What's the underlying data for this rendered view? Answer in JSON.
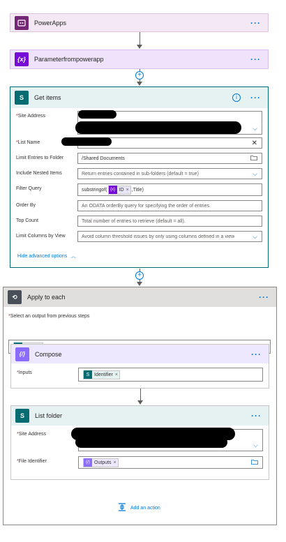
{
  "steps": {
    "powerapps": {
      "title": "PowerApps",
      "icon": "powerapps-icon",
      "color": "#742774"
    },
    "parameter": {
      "title": "Parameterfrompowerapp",
      "icon": "variable-icon",
      "color": "#770bd6"
    },
    "get_items": {
      "title": "Get items",
      "icon": "sharepoint-icon",
      "color": "#036c70",
      "info_icon": "info-icon",
      "fields": {
        "site_address": {
          "label": "Site Address",
          "required": "*"
        },
        "list_name": {
          "label": "List Name",
          "required": "*"
        },
        "limit_folder": {
          "label": "Limit Entries to Folder",
          "value": "/Shared Documents"
        },
        "nested_items": {
          "label": "Include Nested Items",
          "placeholder": "Return entries contained in sub-folders (default = true)"
        },
        "filter_query": {
          "label": "Filter Query",
          "prefix": "substringof(",
          "token": "ID",
          "suffix": ",Title)"
        },
        "order_by": {
          "label": "Order By",
          "placeholder": "An ODATA orderBy query for specifying the order of entries."
        },
        "top_count": {
          "label": "Top Count",
          "placeholder": "Total number of entries to retrieve (default = all)."
        },
        "limit_columns": {
          "label": "Limit Columns by View",
          "placeholder": "Avoid column threshold issues by only using columns defined in a view"
        }
      },
      "hide_advanced": "Hide advanced options"
    },
    "apply_each": {
      "title": "Apply to each",
      "icon": "loop-icon",
      "color": "#484f58",
      "select_label": "Select an output from previous steps",
      "select_required": "*",
      "token": "value"
    },
    "compose": {
      "title": "Compose",
      "icon": "compose-icon",
      "color": "#8c6cff",
      "inputs_label": "Inputs",
      "inputs_required": "*",
      "token": "Identifier"
    },
    "list_folder": {
      "title": "List folder",
      "icon": "sharepoint-icon",
      "color": "#036c70",
      "site_address": {
        "label": "Site Address",
        "required": "*"
      },
      "file_identifier": {
        "label": "File Identifier",
        "required": "*",
        "token": "Outputs"
      }
    }
  },
  "add_action": "Add an action",
  "remove_glyph": "×",
  "dots": "···"
}
